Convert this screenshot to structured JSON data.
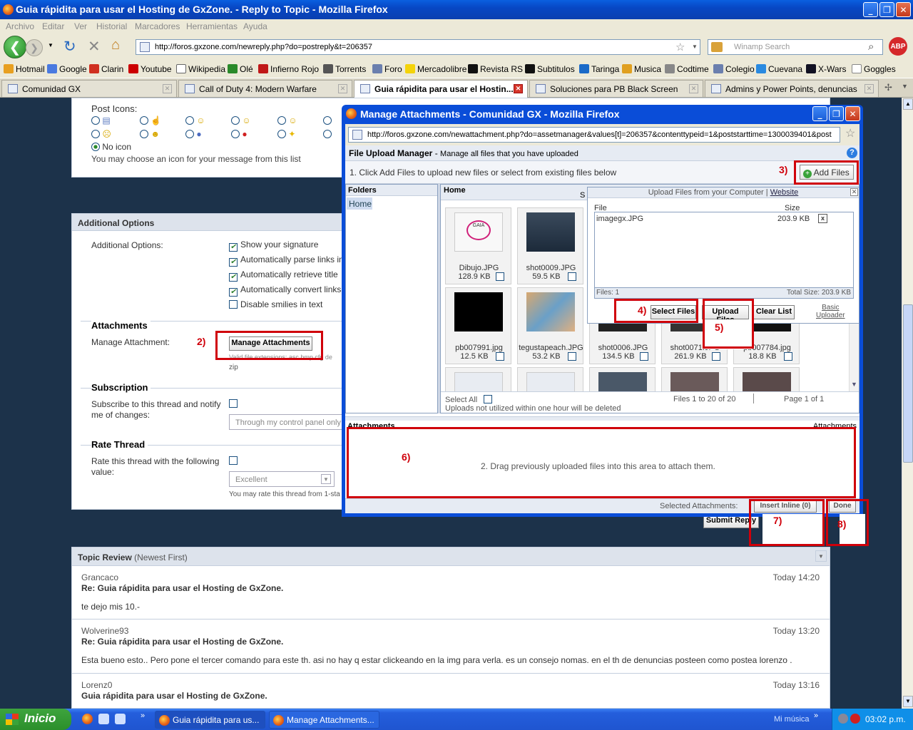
{
  "window": {
    "title": "Guia rápidita para usar el Hosting de GxZone. - Reply to Topic - Mozilla Firefox"
  },
  "menu": [
    "Archivo",
    "Editar",
    "Ver",
    "Historial",
    "Marcadores",
    "Herramientas",
    "Ayuda"
  ],
  "nav": {
    "url": "http://foros.gxzone.com/newreply.php?do=postreply&t=206357",
    "search_placeholder": "Winamp Search"
  },
  "bookmarks": [
    "Hotmail",
    "Google",
    "Clarin",
    "Youtube",
    "Wikipedia",
    "Olé",
    "Infierno Rojo",
    "Torrents",
    "Foro",
    "Mercadolibre",
    "Revista RS",
    "Subtitulos",
    "Taringa",
    "Musica",
    "Codtime",
    "Colegio",
    "Cuevana",
    "X-Wars",
    "Goggles"
  ],
  "tabs": [
    "Comunidad GX",
    "Call of Duty 4: Modern Warfare",
    "Guia rápidita para usar el Hostin...",
    "Soluciones para PB Black Screen",
    "Admins y Power Points, denuncias y s..."
  ],
  "post_icons": {
    "title": "Post Icons:",
    "no_icon": "No icon",
    "hint": "You may choose an icon for your message from this list"
  },
  "additional": {
    "header": "Additional Options",
    "label": "Additional Options:",
    "options": [
      {
        "label": "Show your signature",
        "checked": true
      },
      {
        "label": "Automatically parse links in",
        "checked": true
      },
      {
        "label": "Automatically retrieve title",
        "checked": true
      },
      {
        "label": "Automatically convert links",
        "checked": true
      },
      {
        "label": "Disable smilies in text",
        "checked": false
      }
    ]
  },
  "attachments": {
    "title": "Attachments",
    "label": "Manage Attachment:",
    "button": "Manage Attachments",
    "ext_text": "Valid file extensions: asc bmp cfg de",
    "ext_text2": "zip"
  },
  "subscription": {
    "title": "Subscription",
    "label1": "Subscribe to this thread and notify",
    "label2": "me of changes:",
    "select": "Through my control panel only"
  },
  "rate": {
    "title": "Rate Thread",
    "label1": "Rate this thread with the following",
    "label2": "value:",
    "select": "Excellent",
    "hint": "You may rate this thread from 1-sta"
  },
  "submit": "Submit Reply",
  "review": {
    "title": "Topic Review",
    "subtitle": "(Newest First)",
    "posts": [
      {
        "author": "Grancaco",
        "time": "Today 14:20",
        "title": "Re: Guia rápidita para usar el Hosting de GxZone.",
        "body": "te dejo mis 10.-"
      },
      {
        "author": "Wolverine93",
        "time": "Today 13:20",
        "title": "Re: Guia rápidita para usar el Hosting de GxZone.",
        "body": "Esta bueno esto.. Pero pone el tercer comando para este th. asi no hay q estar clickeando en la img para verla. es un consejo nomas. en el th de denuncias posteen como postea lorenzo ."
      },
      {
        "author": "Lorenz0",
        "time": "Today 13:16",
        "title": "Guia rápidita para usar el Hosting de GxZone.",
        "body": ""
      }
    ]
  },
  "popup": {
    "title": "Manage Attachments - Comunidad GX - Mozilla Firefox",
    "url": "http://foros.gxzone.com/newattachment.php?do=assetmanager&values[t]=206357&contenttypeid=1&poststarttime=1300039401&post",
    "fum_title": "File Upload Manager",
    "fum_sub": "Manage all files that you have uploaded",
    "step1": "1. Click Add Files to upload new files or select from existing files below",
    "add_files": "Add Files",
    "folders_title": "Folders",
    "home_folder": "Home",
    "home_title": "Home",
    "home_s": "S",
    "upload_title": "Upload Files from your Computer",
    "upload_link": "Website",
    "file_col": "File",
    "size_col": "Size",
    "file_name": "imagegx.JPG",
    "file_size": "203.9 KB",
    "files_count": "Files: 1",
    "total_size": "Total Size: 203.9 KB",
    "select_files": "Select Files",
    "upload_files": "Upload Files",
    "clear_list": "Clear List",
    "basic": "Basic",
    "uploader": "Uploader",
    "thumbs": [
      {
        "name": "Dibujo.JPG",
        "size": "128.9 KB"
      },
      {
        "name": "shot0009.JPG",
        "size": "59.5 KB"
      },
      {
        "name": "pb007991.jpg",
        "size": "12.5 KB"
      },
      {
        "name": "tegustapeach.JPG",
        "size": "53.2 KB"
      },
      {
        "name": "shot0006.JPG",
        "size": "134.5 KB"
      },
      {
        "name": "shot0071.JPG",
        "size": "261.9 KB"
      },
      {
        "name": "pb007784.jpg",
        "size": "18.8 KB"
      }
    ],
    "select_all": "Select All",
    "files_range": "Files 1 to 20 of 20",
    "page": "Page 1 of 1",
    "uploads_note": "Uploads not utilized within one hour will be deleted",
    "attach_title": "Attachments",
    "attach_right": "Attachments",
    "drag_text": "2. Drag previously uploaded files into this area to attach them.",
    "selected_label": "Selected Attachments:",
    "insert_inline": "Insert Inline (0)",
    "done": "Done"
  },
  "annotations": [
    "2)",
    "3)",
    "4)",
    "5)",
    "6)",
    "7)",
    "8)"
  ],
  "taskbar": {
    "start": "Inicio",
    "tasks": [
      "Guia rápidita para us...",
      "Manage Attachments..."
    ],
    "music": "Mi música",
    "time": "03:02 p.m."
  },
  "colors": {
    "annotation": "#d0000a",
    "page_bg": "#1c324a",
    "title_blue": "#0747c4"
  }
}
